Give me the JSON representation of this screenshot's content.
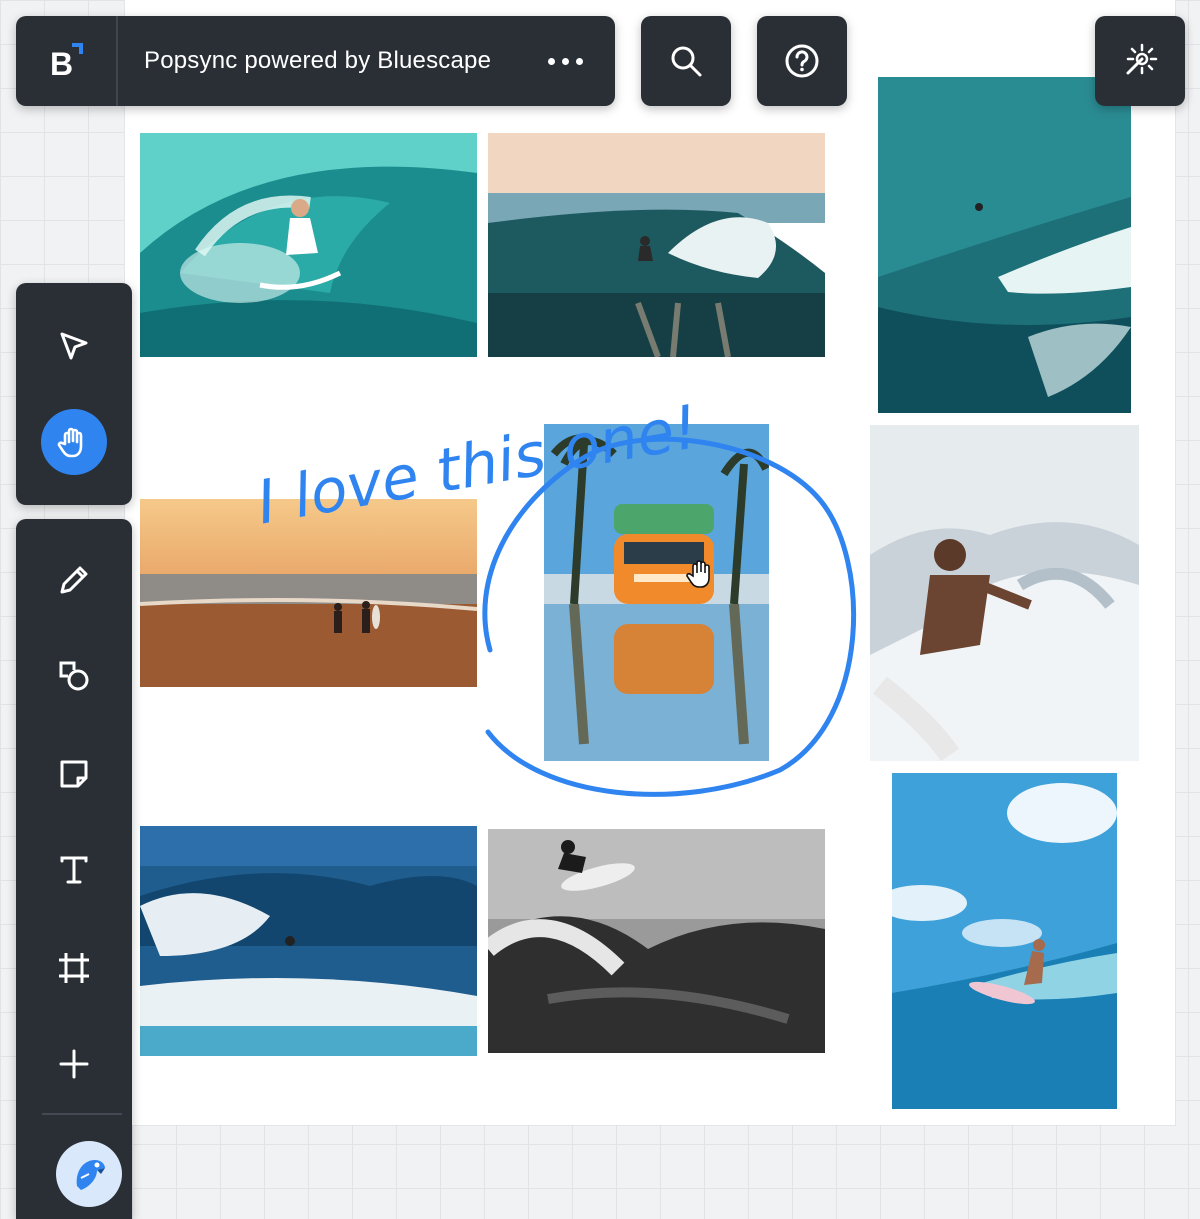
{
  "app": {
    "title": "Popsync powered by Bluescape",
    "logo_letter": "B",
    "brand_color": "#2f84f0",
    "toolbar_color": "#2a2f36"
  },
  "header": {
    "more_icon": "more-horizontal-icon",
    "search_icon": "search-icon",
    "help_icon": "help-circle-icon",
    "magic_icon": "sparkle-wand-icon"
  },
  "left_toolbar": {
    "active_tool": "pan",
    "primary_tools": [
      {
        "name": "select",
        "icon": "pointer-arrow-icon"
      },
      {
        "name": "pan",
        "icon": "hand-icon"
      }
    ],
    "creation_tools": [
      {
        "name": "pencil",
        "icon": "pencil-icon"
      },
      {
        "name": "shapes",
        "icon": "shapes-icon"
      },
      {
        "name": "sticky-note",
        "icon": "sticky-note-icon"
      },
      {
        "name": "text",
        "icon": "text-icon"
      },
      {
        "name": "frame",
        "icon": "frame-crop-icon"
      },
      {
        "name": "add",
        "icon": "plus-icon"
      }
    ],
    "avatar_icon": "parrot-avatar-icon"
  },
  "canvas": {
    "annotation_text": "I love this one!",
    "annotation_color": "#2f84f0",
    "images": [
      {
        "subject": "surfer in barrel wave"
      },
      {
        "subject": "surfer on wave at dusk"
      },
      {
        "subject": "aerial surfer on big wave"
      },
      {
        "subject": "surfers walking on beach at sunset"
      },
      {
        "subject": "orange van with surfboards reflected in puddle"
      },
      {
        "subject": "surfer carving through spray"
      },
      {
        "subject": "surfer on crashing blue wave"
      },
      {
        "subject": "black and white surfer aerial"
      },
      {
        "subject": "surfer riding wave under blue sky"
      }
    ]
  }
}
